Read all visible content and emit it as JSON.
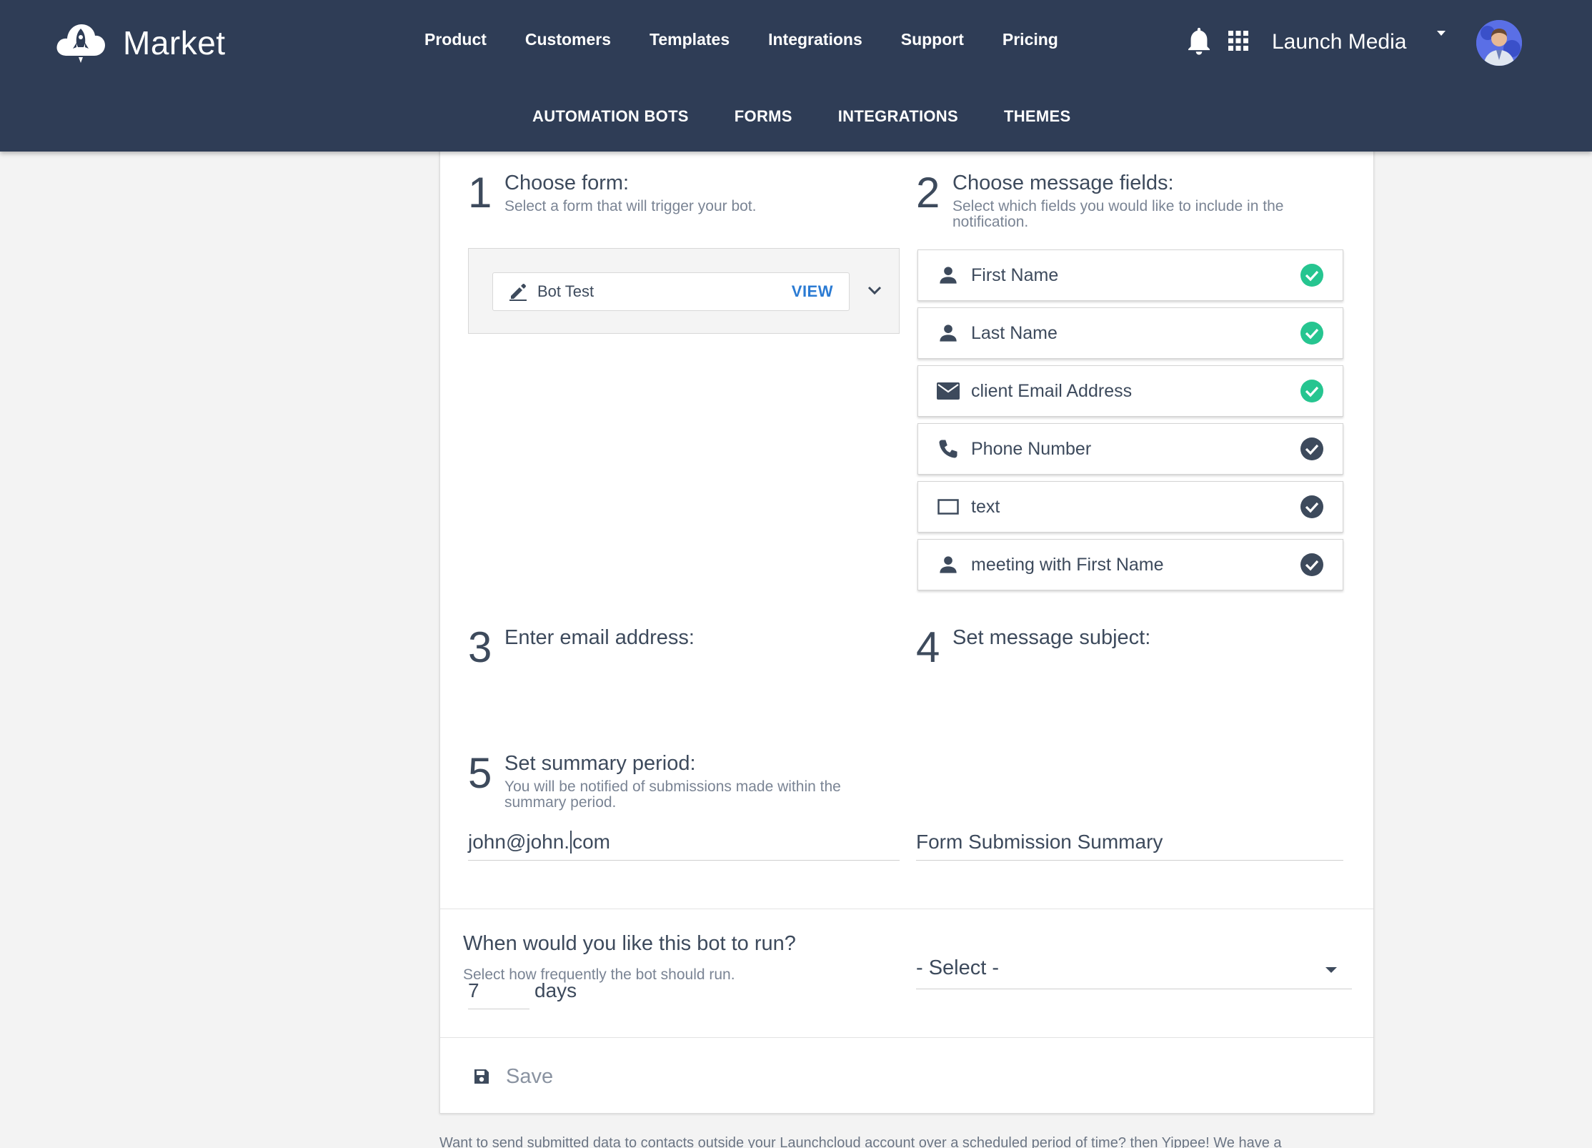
{
  "header": {
    "brand": "Market",
    "nav": [
      "Product",
      "Customers",
      "Templates",
      "Integrations",
      "Support",
      "Pricing"
    ],
    "account_name": "Launch Media",
    "subnav": [
      "AUTOMATION BOTS",
      "FORMS",
      "INTEGRATIONS",
      "THEMES"
    ]
  },
  "step1": {
    "number": "1",
    "title": "Choose form:",
    "subtitle": "Select a form that will trigger your bot.",
    "selected_form": "Bot Test",
    "view_label": "VIEW"
  },
  "step2": {
    "number": "2",
    "title": "Choose message fields:",
    "subtitle_line1": "Select which fields you would like to include in the",
    "subtitle_line2": "notification.",
    "fields": [
      {
        "label": "First Name",
        "icon": "person-icon",
        "checked": true
      },
      {
        "label": "Last Name",
        "icon": "person-icon",
        "checked": true
      },
      {
        "label": "client Email Address",
        "icon": "envelope-icon",
        "checked": true
      },
      {
        "label": "Phone Number",
        "icon": "phone-icon",
        "checked": false
      },
      {
        "label": "text",
        "icon": "textbox-icon",
        "checked": false
      },
      {
        "label": "meeting with First Name",
        "icon": "person-icon",
        "checked": false
      }
    ]
  },
  "step3": {
    "number": "3",
    "title": "Enter email address:",
    "value_before_cursor": "john@john.",
    "value_after_cursor": "com"
  },
  "step4": {
    "number": "4",
    "title": "Set message subject:",
    "value": "Form Submission Summary"
  },
  "step5": {
    "number": "5",
    "title": "Set summary period:",
    "subtitle_line1": "You will be notified of submissions made within the",
    "subtitle_line2": "summary period.",
    "value": "7",
    "unit": "days"
  },
  "run": {
    "title": "When would you like this bot to run?",
    "subtitle": "Select how frequently the bot should run.",
    "select_value": "- Select -"
  },
  "save_label": "Save",
  "footer_text": "Want to send submitted data to contacts outside your Launchcloud account over a scheduled period of time? then Yippee! We have a",
  "colors": {
    "header_bg": "#2f3d56",
    "check_selected": "#26c590",
    "check_unselected": "#3d4a5c",
    "link": "#2b7bd3"
  }
}
